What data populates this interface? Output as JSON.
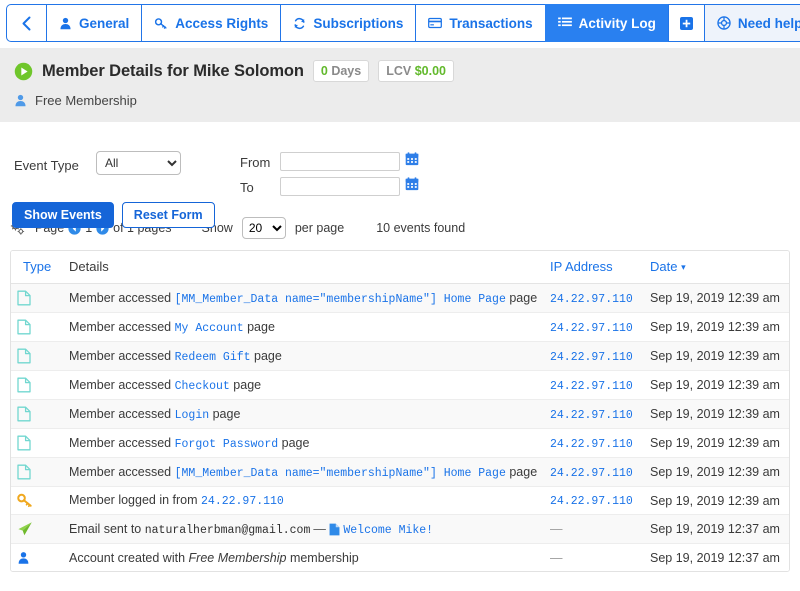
{
  "tabs": [
    {
      "label": "",
      "icon": "chevron-left-icon",
      "name": "back-button"
    },
    {
      "label": "General",
      "icon": "user-icon",
      "name": "tab-general"
    },
    {
      "label": "Access Rights",
      "icon": "key-icon",
      "name": "tab-access-rights"
    },
    {
      "label": "Subscriptions",
      "icon": "refresh-icon",
      "name": "tab-subscriptions"
    },
    {
      "label": "Transactions",
      "icon": "card-icon",
      "name": "tab-transactions"
    },
    {
      "label": "Activity Log",
      "icon": "list-icon",
      "name": "tab-activity-log"
    },
    {
      "label": "",
      "icon": "plus-icon",
      "name": "add-tab-button"
    },
    {
      "label": "Need help?",
      "icon": "lifebuoy-icon",
      "name": "tab-need-help"
    }
  ],
  "member": {
    "title": "Member Details for Mike Solomon",
    "days_value": "0",
    "days_label": "Days",
    "lcv_label": "LCV",
    "lcv_value": "$0.00",
    "membership": "Free Membership"
  },
  "filters": {
    "event_type_label": "Event Type",
    "event_type_value": "All",
    "event_type_options": [
      "All"
    ],
    "from_label": "From",
    "from_value": "",
    "to_label": "To",
    "to_value": "",
    "show_events_label": "Show Events",
    "reset_form_label": "Reset Form"
  },
  "pagination": {
    "page_word": "Page",
    "current_page": "1",
    "of_pages": "of 1 pages",
    "show_label": "Show",
    "per_page_value": "20",
    "per_page_options": [
      "20"
    ],
    "per_page_label": "per page",
    "events_found": "10 events found"
  },
  "table": {
    "columns": {
      "type": "Type",
      "details": "Details",
      "ip": "IP Address",
      "date": "Date"
    },
    "sort_caret": "▾",
    "rows": [
      {
        "icon": "document-icon",
        "prefix": "Member accessed ",
        "code": "[MM_Member_Data name=\"membershipName\"] Home Page",
        "suffix": " page",
        "ip": "24.22.97.110",
        "date": "Sep 19, 2019 12:39 am"
      },
      {
        "icon": "document-icon",
        "prefix": "Member accessed ",
        "code": "My Account",
        "suffix": " page",
        "ip": "24.22.97.110",
        "date": "Sep 19, 2019 12:39 am"
      },
      {
        "icon": "document-icon",
        "prefix": "Member accessed ",
        "code": "Redeem Gift",
        "suffix": " page",
        "ip": "24.22.97.110",
        "date": "Sep 19, 2019 12:39 am"
      },
      {
        "icon": "document-icon",
        "prefix": "Member accessed ",
        "code": "Checkout",
        "suffix": " page",
        "ip": "24.22.97.110",
        "date": "Sep 19, 2019 12:39 am"
      },
      {
        "icon": "document-icon",
        "prefix": "Member accessed ",
        "code": "Login",
        "suffix": " page",
        "ip": "24.22.97.110",
        "date": "Sep 19, 2019 12:39 am"
      },
      {
        "icon": "document-icon",
        "prefix": "Member accessed ",
        "code": "Forgot Password",
        "suffix": " page",
        "ip": "24.22.97.110",
        "date": "Sep 19, 2019 12:39 am"
      },
      {
        "icon": "document-icon",
        "prefix": "Member accessed ",
        "code": "[MM_Member_Data name=\"membershipName\"] Home Page",
        "suffix": " page",
        "ip": "24.22.97.110",
        "date": "Sep 19, 2019 12:39 am"
      },
      {
        "icon": "key-icon",
        "prefix": "Member logged in from ",
        "code": "24.22.97.110",
        "suffix": "",
        "ip": "24.22.97.110",
        "date": "Sep 19, 2019 12:39 am"
      },
      {
        "icon": "paper-plane-icon",
        "prefix": "Email sent to ",
        "email": "naturalherbman@gmail.com",
        "separator": "—",
        "email_subject": "Welcome Mike!",
        "ip": "—",
        "date": "Sep 19, 2019 12:37 am"
      },
      {
        "icon": "person-icon",
        "prefix": "Account created with ",
        "italic": "Free Membership",
        "suffix": " membership",
        "ip": "—",
        "date": "Sep 19, 2019 12:37 am"
      }
    ]
  },
  "colors": {
    "accent_blue": "#1a73e8",
    "active_tab_blue": "#2980f0",
    "green": "#62b92c",
    "band_gray": "#ececec",
    "key_orange": "#f0a81e",
    "doc_teal": "#72d7d0"
  }
}
